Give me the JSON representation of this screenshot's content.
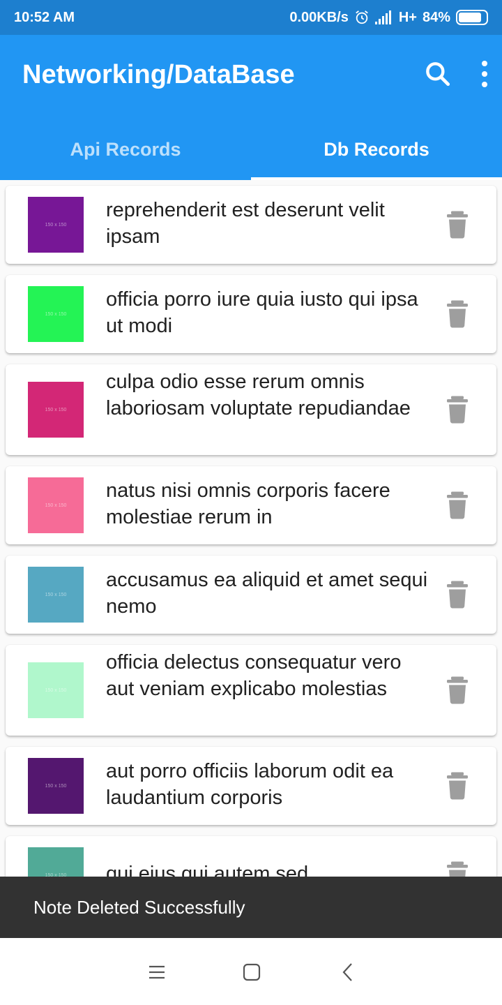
{
  "status": {
    "time": "10:52 AM",
    "net_speed": "0.00KB/s",
    "network": "H+",
    "battery": "84%",
    "battery_level": 0.84
  },
  "appbar": {
    "title": "Networking/DataBase",
    "search_icon": "search-icon",
    "more_icon": "more-vert-icon"
  },
  "tabs": [
    {
      "label": "Api Records",
      "selected": false
    },
    {
      "label": "Db Records",
      "selected": true
    }
  ],
  "records": [
    {
      "text": "reprehenderit est deserunt velit ipsam",
      "color": "#771796",
      "thumb_label": "150 x 150"
    },
    {
      "text": "officia porro iure quia iusto qui ipsa ut modi",
      "color": "#24f355",
      "thumb_label": "150 x 150"
    },
    {
      "text": "culpa odio esse rerum omnis laboriosam voluptate repudiandae",
      "color": "#d32776",
      "thumb_label": "150 x 150"
    },
    {
      "text": "natus nisi omnis corporis facere molestiae rerum in",
      "color": "#f66b97",
      "thumb_label": "150 x 150"
    },
    {
      "text": "accusamus ea aliquid et amet sequi nemo",
      "color": "#56a8c2",
      "thumb_label": "150 x 150"
    },
    {
      "text": "officia delectus consequatur vero aut veniam explicabo molestias",
      "color": "#b0f7cc",
      "thumb_label": "150 x 150"
    },
    {
      "text": "aut porro officiis laborum odit ea laudantium corporis",
      "color": "#54176f",
      "thumb_label": "150 x 150"
    },
    {
      "text": "qui eius qui autem sed",
      "color": "#51aa97",
      "thumb_label": "150 x 150"
    }
  ],
  "snackbar": {
    "message": "Note Deleted Successfully"
  },
  "navbar": {
    "menu_icon": "menu-icon",
    "home_icon": "home-icon",
    "back_icon": "back-icon"
  },
  "colors": {
    "primary": "#2196f3",
    "status_bar": "#1d7fcf",
    "delete_icon": "#9e9e9e",
    "snackbar": "#323232"
  }
}
